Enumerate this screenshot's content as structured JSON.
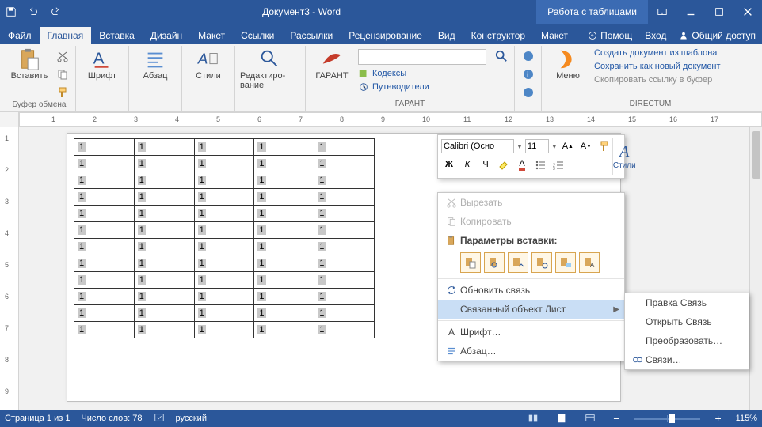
{
  "title": "Документ3 - Word",
  "titleExtra": "Работа с таблицами",
  "tabs": {
    "file": "Файл",
    "home": "Главная",
    "insert": "Вставка",
    "design": "Дизайн",
    "layout": "Макет",
    "references": "Ссылки",
    "mailings": "Рассылки",
    "review": "Рецензирование",
    "view": "Вид",
    "tableDesign": "Конструктор",
    "tableLayout": "Макет",
    "help": "Помощ",
    "signin": "Вход",
    "share": "Общий доступ"
  },
  "ribbon": {
    "clipboard": {
      "paste": "Вставить",
      "groupLabel": "Буфер обмена"
    },
    "font": "Шрифт",
    "paragraph": "Абзац",
    "styles": "Стили",
    "editing": "Редактиро­вание",
    "garant": {
      "name": "ГАРАНТ",
      "codex": "Кодексы",
      "guides": "Путеводители",
      "groupLabel": "ГАРАНТ"
    },
    "directum": {
      "menu": "Меню",
      "create": "Создать документ из шаблона",
      "saveas": "Сохранить как новый документ",
      "copy": "Скопировать ссылку в буфер",
      "groupLabel": "DIRECTUM"
    }
  },
  "minitool": {
    "font": "Calibri (Осно",
    "size": "11",
    "bold": "Ж",
    "italic": "К",
    "underline": "Ч",
    "styles": "Стили"
  },
  "ctx": {
    "cut": "Вырезать",
    "copy": "Копировать",
    "pasteHeader": "Параметры вставки:",
    "updateLink": "Обновить связь",
    "linkedObject": "Связанный объект Лист",
    "font": "Шрифт…",
    "paragraph": "Абзац…"
  },
  "submenu": {
    "editLink": "Правка  Связь",
    "openLink": "Открыть  Связь",
    "convert": "Преобразовать…",
    "links": "Связи…"
  },
  "table": {
    "cell": "1",
    "rows": 12,
    "cols": 5
  },
  "ruler": {
    "ticks": [
      "1",
      "2",
      "3",
      "4",
      "5",
      "6",
      "7",
      "8",
      "9",
      "10",
      "11",
      "12",
      "13",
      "14",
      "15",
      "16",
      "17"
    ],
    "vticks": [
      "1",
      "2",
      "3",
      "4",
      "5",
      "6",
      "7",
      "8",
      "9"
    ]
  },
  "status": {
    "page": "Страница 1 из 1",
    "words": "Число слов: 78",
    "lang": "русский",
    "zoom": "115%"
  }
}
